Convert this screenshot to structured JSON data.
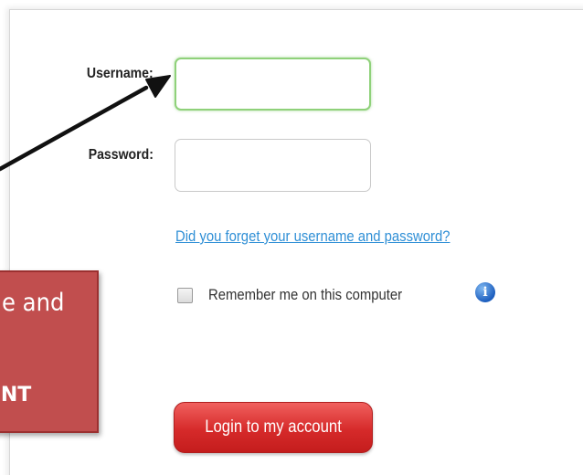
{
  "form": {
    "username_label": "Username:",
    "username_value": "",
    "password_label": "Password:",
    "password_value": "",
    "forgot_link": "Did you forget your username and password?",
    "remember_label": "Remember me on this computer",
    "remember_checked": false,
    "info_icon": "info-icon",
    "login_button": "Login to my account"
  },
  "callout": {
    "line1": "e and",
    "line2": "UNT"
  },
  "colors": {
    "link": "#2f8fd6",
    "button": "#d62a2a",
    "callout": "#c14e4e",
    "active_border": "#8fd17a"
  }
}
